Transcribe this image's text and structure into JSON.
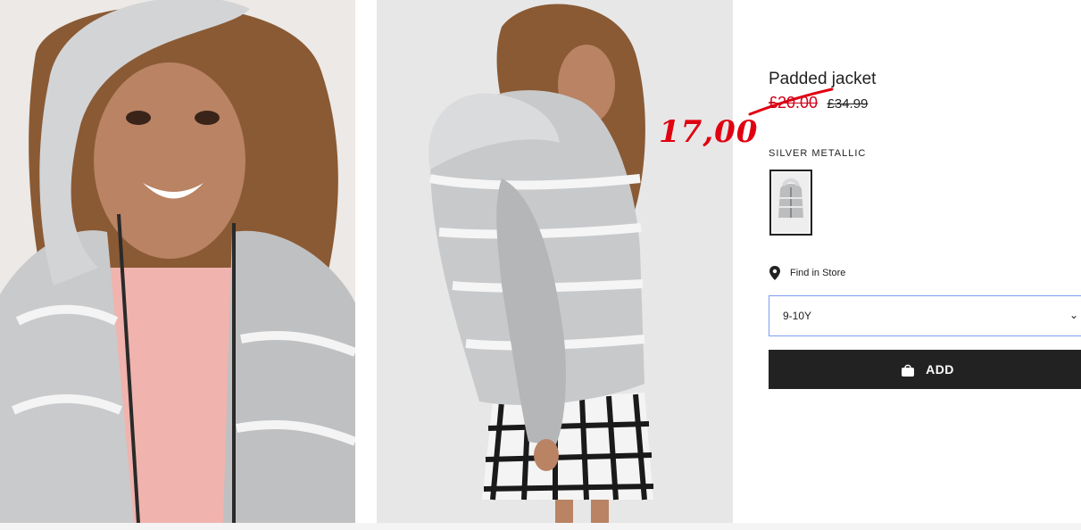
{
  "product": {
    "title": "Padded jacket",
    "sale_price": "£20.00",
    "original_price": "£34.99",
    "color_label": "SILVER METALLIC",
    "find_in_store": "Find in Store",
    "size_selected": "9-10Y",
    "add_button_label": "ADD"
  },
  "annotation": {
    "handwritten_price": "17,00"
  },
  "icons": {
    "store": "map-pin-icon",
    "bag": "shopping-bag-icon",
    "dropdown": "chevron-down-icon"
  },
  "colors": {
    "sale_red": "#d0021b",
    "annotation_red": "#e00010",
    "button_black": "#222222",
    "select_border": "#7a9ef0"
  }
}
